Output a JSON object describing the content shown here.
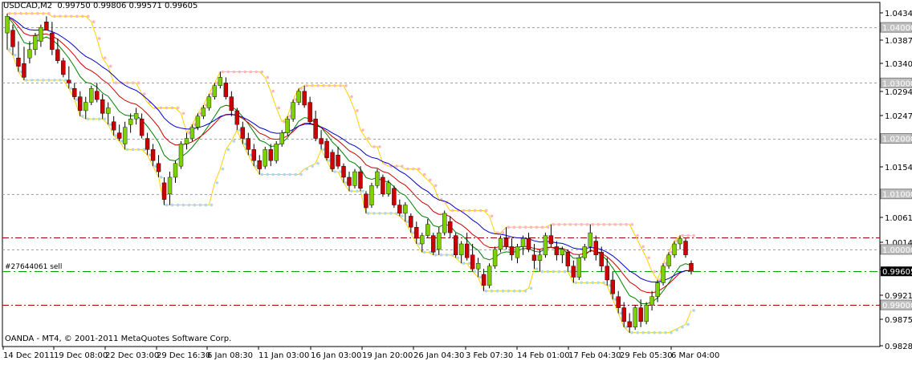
{
  "header": {
    "symbol": "USDCAD,M2",
    "ohlc": "0.99750 0.99806 0.99571 0.99605"
  },
  "footer": {
    "copyright": "OANDA - MT4, © 2001-2011 MetaQuotes Software Corp."
  },
  "order_label": "#27644061 sell",
  "colors": {
    "background": "#ffffff",
    "bull": "#7ed100",
    "bear": "#cc0000",
    "ma_fast": "#008000",
    "ma_mid": "#cc0000",
    "ma_slow": "#0000cc",
    "channel": "#ffd000",
    "resistance_dots": "#ffb6c1",
    "support_dots": "#add8e6",
    "gridline": "#a0a0a0",
    "order_line": "#00a000",
    "level_line": "#a00000"
  },
  "chart_data": {
    "type": "candlestick",
    "title": "USDCAD,M2",
    "ylim": [
      0.9825,
      1.0445
    ],
    "y_ticks": [
      "1.04340",
      "1.03870",
      "1.03400",
      "1.02940",
      "1.02470",
      "1.01540",
      "1.01080",
      "1.00610",
      "1.00140",
      "0.99680",
      "0.99210",
      "0.98750",
      "0.98280"
    ],
    "x_ticks": [
      "14 Dec 2011",
      "19 Dec 08:00",
      "22 Dec 03:00",
      "29 Dec 16:30",
      "6 Jan 08:30",
      "11 Jan 03:00",
      "16 Jan 03:00",
      "19 Jan 20:00",
      "26 Jan 04:30",
      "3 Feb 07:30",
      "14 Feb 01:00",
      "17 Feb 04:30",
      "29 Feb 05:30",
      "6 Mar 04:00"
    ],
    "hlines": [
      {
        "price": 1.04,
        "label": "1.04000",
        "style": "dashed-gray",
        "boxed": true
      },
      {
        "price": 1.03,
        "label": "1.03000",
        "style": "dashed-gray",
        "boxed": true
      },
      {
        "price": 1.02,
        "label": "1.02000",
        "style": "dashed-gray",
        "boxed": true
      },
      {
        "price": 1.01,
        "label": "1.01000",
        "style": "dashed-gray",
        "boxed": true
      },
      {
        "price": 1.0,
        "label": "1.00000",
        "style": "dashed-gray",
        "boxed": true
      },
      {
        "price": 0.99,
        "label": "0.99000",
        "style": "dashdot-red",
        "boxed": true
      },
      {
        "price": 1.0022,
        "label": "",
        "style": "dashdot-red",
        "boxed": false
      }
    ],
    "order_line": {
      "price": 0.99605,
      "label": "0.99605"
    },
    "candles": [
      {
        "o": 1.039,
        "h": 1.0425,
        "l": 1.036,
        "c": 1.042
      },
      {
        "o": 1.0395,
        "h": 1.0405,
        "l": 1.035,
        "c": 1.0365
      },
      {
        "o": 1.0345,
        "h": 1.0375,
        "l": 1.032,
        "c": 1.033
      },
      {
        "o": 1.0335,
        "h": 1.0365,
        "l": 1.0305,
        "c": 1.031
      },
      {
        "o": 1.0345,
        "h": 1.0375,
        "l": 1.0335,
        "c": 1.036
      },
      {
        "o": 1.036,
        "h": 1.039,
        "l": 1.035,
        "c": 1.0385
      },
      {
        "o": 1.0375,
        "h": 1.0405,
        "l": 1.0365,
        "c": 1.04
      },
      {
        "o": 1.041,
        "h": 1.042,
        "l": 1.0395,
        "c": 1.0395
      },
      {
        "o": 1.039,
        "h": 1.041,
        "l": 1.035,
        "c": 1.036
      },
      {
        "o": 1.036,
        "h": 1.038,
        "l": 1.0335,
        "c": 1.034
      },
      {
        "o": 1.034,
        "h": 1.0345,
        "l": 1.031,
        "c": 1.0315
      },
      {
        "o": 1.0305,
        "h": 1.033,
        "l": 1.029,
        "c": 1.03
      },
      {
        "o": 1.029,
        "h": 1.03,
        "l": 1.027,
        "c": 1.0275
      },
      {
        "o": 1.0275,
        "h": 1.0285,
        "l": 1.024,
        "c": 1.025
      },
      {
        "o": 1.025,
        "h": 1.0275,
        "l": 1.0235,
        "c": 1.0265
      },
      {
        "o": 1.0265,
        "h": 1.0295,
        "l": 1.026,
        "c": 1.029
      },
      {
        "o": 1.0285,
        "h": 1.03,
        "l": 1.0265,
        "c": 1.027
      },
      {
        "o": 1.027,
        "h": 1.028,
        "l": 1.0235,
        "c": 1.0245
      },
      {
        "o": 1.0245,
        "h": 1.0265,
        "l": 1.0225,
        "c": 1.0255
      },
      {
        "o": 1.023,
        "h": 1.024,
        "l": 1.0205,
        "c": 1.0215
      },
      {
        "o": 1.021,
        "h": 1.0225,
        "l": 1.0195,
        "c": 1.02
      },
      {
        "o": 1.019,
        "h": 1.023,
        "l": 1.018,
        "c": 1.022
      },
      {
        "o": 1.0225,
        "h": 1.0245,
        "l": 1.021,
        "c": 1.0235
      },
      {
        "o": 1.0235,
        "h": 1.0255,
        "l": 1.0225,
        "c": 1.0245
      },
      {
        "o": 1.0235,
        "h": 1.0245,
        "l": 1.02,
        "c": 1.0205
      },
      {
        "o": 1.02,
        "h": 1.021,
        "l": 1.017,
        "c": 1.018
      },
      {
        "o": 1.018,
        "h": 1.019,
        "l": 1.015,
        "c": 1.016
      },
      {
        "o": 1.0155,
        "h": 1.017,
        "l": 1.013,
        "c": 1.014
      },
      {
        "o": 1.012,
        "h": 1.013,
        "l": 1.008,
        "c": 1.009
      },
      {
        "o": 1.01,
        "h": 1.014,
        "l": 1.008,
        "c": 1.013
      },
      {
        "o": 1.013,
        "h": 1.016,
        "l": 1.012,
        "c": 1.0155
      },
      {
        "o": 1.015,
        "h": 1.0195,
        "l": 1.0145,
        "c": 1.019
      },
      {
        "o": 1.019,
        "h": 1.021,
        "l": 1.018,
        "c": 1.02
      },
      {
        "o": 1.02,
        "h": 1.0225,
        "l": 1.0195,
        "c": 1.022
      },
      {
        "o": 1.022,
        "h": 1.0245,
        "l": 1.0215,
        "c": 1.024
      },
      {
        "o": 1.024,
        "h": 1.026,
        "l": 1.0235,
        "c": 1.0255
      },
      {
        "o": 1.0255,
        "h": 1.028,
        "l": 1.025,
        "c": 1.0275
      },
      {
        "o": 1.0275,
        "h": 1.03,
        "l": 1.027,
        "c": 1.0295
      },
      {
        "o": 1.0295,
        "h": 1.032,
        "l": 1.029,
        "c": 1.031
      },
      {
        "o": 1.03,
        "h": 1.031,
        "l": 1.027,
        "c": 1.0275
      },
      {
        "o": 1.0275,
        "h": 1.0285,
        "l": 1.024,
        "c": 1.025
      },
      {
        "o": 1.025,
        "h": 1.0255,
        "l": 1.0215,
        "c": 1.0225
      },
      {
        "o": 1.022,
        "h": 1.023,
        "l": 1.019,
        "c": 1.02
      },
      {
        "o": 1.02,
        "h": 1.021,
        "l": 1.017,
        "c": 1.018
      },
      {
        "o": 1.018,
        "h": 1.019,
        "l": 1.015,
        "c": 1.016
      },
      {
        "o": 1.016,
        "h": 1.017,
        "l": 1.0135,
        "c": 1.0145
      },
      {
        "o": 1.015,
        "h": 1.0185,
        "l": 1.0145,
        "c": 1.018
      },
      {
        "o": 1.018,
        "h": 1.019,
        "l": 1.015,
        "c": 1.016
      },
      {
        "o": 1.016,
        "h": 1.0195,
        "l": 1.0155,
        "c": 1.019
      },
      {
        "o": 1.019,
        "h": 1.0215,
        "l": 1.0185,
        "c": 1.021
      },
      {
        "o": 1.021,
        "h": 1.024,
        "l": 1.0205,
        "c": 1.0235
      },
      {
        "o": 1.0235,
        "h": 1.027,
        "l": 1.023,
        "c": 1.0265
      },
      {
        "o": 1.0265,
        "h": 1.029,
        "l": 1.026,
        "c": 1.0285
      },
      {
        "o": 1.0285,
        "h": 1.0295,
        "l": 1.0255,
        "c": 1.026
      },
      {
        "o": 1.0265,
        "h": 1.0275,
        "l": 1.0225,
        "c": 1.023
      },
      {
        "o": 1.0235,
        "h": 1.025,
        "l": 1.0195,
        "c": 1.02
      },
      {
        "o": 1.02,
        "h": 1.0215,
        "l": 1.018,
        "c": 1.019
      },
      {
        "o": 1.0195,
        "h": 1.02,
        "l": 1.016,
        "c": 1.0165
      },
      {
        "o": 1.0175,
        "h": 1.018,
        "l": 1.014,
        "c": 1.0145
      },
      {
        "o": 1.017,
        "h": 1.0185,
        "l": 1.0145,
        "c": 1.015
      },
      {
        "o": 1.015,
        "h": 1.0155,
        "l": 1.012,
        "c": 1.013
      },
      {
        "o": 1.013,
        "h": 1.014,
        "l": 1.0105,
        "c": 1.0115
      },
      {
        "o": 1.0115,
        "h": 1.0145,
        "l": 1.011,
        "c": 1.014
      },
      {
        "o": 1.014,
        "h": 1.015,
        "l": 1.0105,
        "c": 1.011
      },
      {
        "o": 1.01,
        "h": 1.0105,
        "l": 1.0065,
        "c": 1.0075
      },
      {
        "o": 1.008,
        "h": 1.012,
        "l": 1.0075,
        "c": 1.0115
      },
      {
        "o": 1.0115,
        "h": 1.0145,
        "l": 1.011,
        "c": 1.014
      },
      {
        "o": 1.013,
        "h": 1.0135,
        "l": 1.0095,
        "c": 1.01
      },
      {
        "o": 1.01,
        "h": 1.0125,
        "l": 1.0095,
        "c": 1.012
      },
      {
        "o": 1.011,
        "h": 1.0115,
        "l": 1.0075,
        "c": 1.008
      },
      {
        "o": 1.008,
        "h": 1.009,
        "l": 1.006,
        "c": 1.0065
      },
      {
        "o": 1.0065,
        "h": 1.0085,
        "l": 1.005,
        "c": 1.008
      },
      {
        "o": 1.006,
        "h": 1.0065,
        "l": 1.003,
        "c": 1.004
      },
      {
        "o": 1.004,
        "h": 1.005,
        "l": 1.001,
        "c": 1.002
      },
      {
        "o": 1.001,
        "h": 1.003,
        "l": 0.9995,
        "c": 1.0025
      },
      {
        "o": 1.0025,
        "h": 1.0055,
        "l": 1.002,
        "c": 1.0045
      },
      {
        "o": 1.0025,
        "h": 1.003,
        "l": 0.999,
        "c": 0.9995
      },
      {
        "o": 1.0,
        "h": 1.004,
        "l": 0.999,
        "c": 1.003
      },
      {
        "o": 1.003,
        "h": 1.007,
        "l": 1.0025,
        "c": 1.0065
      },
      {
        "o": 1.005,
        "h": 1.006,
        "l": 1.002,
        "c": 1.003
      },
      {
        "o": 1.0025,
        "h": 1.003,
        "l": 0.9985,
        "c": 0.999
      },
      {
        "o": 0.999,
        "h": 1.0015,
        "l": 0.9975,
        "c": 1.001
      },
      {
        "o": 1.001,
        "h": 1.003,
        "l": 0.998,
        "c": 0.9985
      },
      {
        "o": 0.999,
        "h": 1.001,
        "l": 0.996,
        "c": 0.9965
      },
      {
        "o": 0.9965,
        "h": 0.9985,
        "l": 0.995,
        "c": 0.9975
      },
      {
        "o": 0.9955,
        "h": 0.9965,
        "l": 0.9925,
        "c": 0.9935
      },
      {
        "o": 0.9935,
        "h": 0.9975,
        "l": 0.993,
        "c": 0.997
      },
      {
        "o": 0.997,
        "h": 1.0005,
        "l": 0.9965,
        "c": 1.0
      },
      {
        "o": 1.0,
        "h": 1.0025,
        "l": 0.9995,
        "c": 1.002
      },
      {
        "o": 1.002,
        "h": 1.004,
        "l": 1.0,
        "c": 1.0005
      },
      {
        "o": 1.0005,
        "h": 1.002,
        "l": 0.998,
        "c": 0.999
      },
      {
        "o": 0.9985,
        "h": 1.001,
        "l": 0.9975,
        "c": 1.0005
      },
      {
        "o": 1.0005,
        "h": 1.0025,
        "l": 0.999,
        "c": 1.002
      },
      {
        "o": 1.002,
        "h": 1.003,
        "l": 0.9995,
        "c": 1.0
      },
      {
        "o": 0.999,
        "h": 1.001,
        "l": 0.9965,
        "c": 0.998
      },
      {
        "o": 0.998,
        "h": 1.0,
        "l": 0.996,
        "c": 0.999
      },
      {
        "o": 0.999,
        "h": 1.003,
        "l": 0.9985,
        "c": 1.0025
      },
      {
        "o": 1.0025,
        "h": 1.0045,
        "l": 1.0005,
        "c": 1.001
      },
      {
        "o": 1.0005,
        "h": 1.0015,
        "l": 0.998,
        "c": 0.999
      },
      {
        "o": 0.999,
        "h": 1.0005,
        "l": 0.9975,
        "c": 1.0
      },
      {
        "o": 0.9995,
        "h": 1.0,
        "l": 0.996,
        "c": 0.997
      },
      {
        "o": 0.997,
        "h": 0.998,
        "l": 0.994,
        "c": 0.995
      },
      {
        "o": 0.995,
        "h": 0.999,
        "l": 0.9945,
        "c": 0.9985
      },
      {
        "o": 0.9985,
        "h": 1.001,
        "l": 0.998,
        "c": 1.0005
      },
      {
        "o": 1.0005,
        "h": 1.0045,
        "l": 0.9995,
        "c": 1.003
      },
      {
        "o": 1.0015,
        "h": 1.0025,
        "l": 0.998,
        "c": 0.999
      },
      {
        "o": 0.9995,
        "h": 1.0005,
        "l": 0.996,
        "c": 0.997
      },
      {
        "o": 0.997,
        "h": 0.9985,
        "l": 0.9935,
        "c": 0.9945
      },
      {
        "o": 0.9945,
        "h": 0.996,
        "l": 0.991,
        "c": 0.992
      },
      {
        "o": 0.9915,
        "h": 0.9925,
        "l": 0.9885,
        "c": 0.9895
      },
      {
        "o": 0.9895,
        "h": 0.9905,
        "l": 0.986,
        "c": 0.987
      },
      {
        "o": 0.987,
        "h": 0.9885,
        "l": 0.985,
        "c": 0.986
      },
      {
        "o": 0.986,
        "h": 0.99,
        "l": 0.9855,
        "c": 0.9895
      },
      {
        "o": 0.9895,
        "h": 0.991,
        "l": 0.986,
        "c": 0.987
      },
      {
        "o": 0.987,
        "h": 0.9905,
        "l": 0.9865,
        "c": 0.99
      },
      {
        "o": 0.99,
        "h": 0.9925,
        "l": 0.989,
        "c": 0.9915
      },
      {
        "o": 0.9915,
        "h": 0.9945,
        "l": 0.9905,
        "c": 0.994
      },
      {
        "o": 0.994,
        "h": 0.9975,
        "l": 0.9935,
        "c": 0.997
      },
      {
        "o": 0.997,
        "h": 0.9995,
        "l": 0.9965,
        "c": 0.999
      },
      {
        "o": 0.999,
        "h": 1.0015,
        "l": 0.9985,
        "c": 1.001
      },
      {
        "o": 1.001,
        "h": 1.0025,
        "l": 1.0,
        "c": 1.002
      },
      {
        "o": 1.0015,
        "h": 1.002,
        "l": 0.9985,
        "c": 0.999
      },
      {
        "o": 0.9975,
        "h": 0.998,
        "l": 0.9955,
        "c": 0.99605
      }
    ]
  }
}
